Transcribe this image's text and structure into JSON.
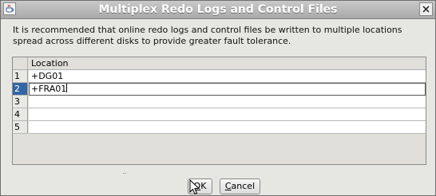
{
  "window": {
    "title": "Multiplex Redo Logs and Control Files"
  },
  "message": "It is recommended that online redo logs and control files be  written to multiple locations spread across different disks to provide greater fault tolerance.",
  "table": {
    "column_header": "Location",
    "rows": [
      {
        "num": "1",
        "location": "+DG01"
      },
      {
        "num": "2",
        "location": "+FRA01"
      },
      {
        "num": "3",
        "location": ""
      },
      {
        "num": "4",
        "location": ""
      },
      {
        "num": "5",
        "location": ""
      }
    ],
    "selected_row": 2
  },
  "buttons": {
    "ok_label_mnemonic": "O",
    "ok_label_rest": "K",
    "cancel_label_mnemonic": "C",
    "cancel_label_rest": "ancel"
  },
  "icons": {
    "window_icon": "java-cup-icon",
    "close": "close-icon",
    "pointer": "mouse-pointer-icon"
  }
}
